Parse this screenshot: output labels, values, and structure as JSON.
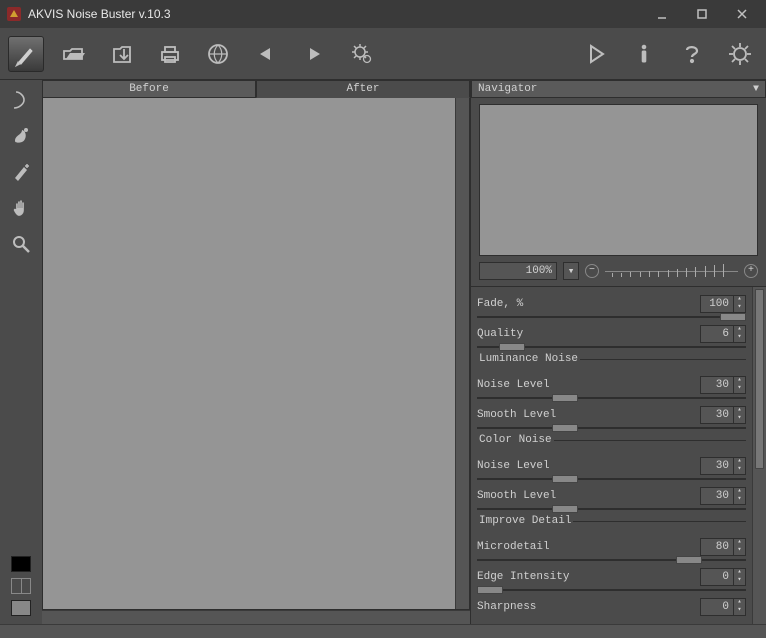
{
  "app": {
    "title": "AKVIS Noise Buster v.10.3"
  },
  "tabs": {
    "before": "Before",
    "after": "After"
  },
  "navigator": {
    "title": "Navigator",
    "zoom_value": "100%",
    "minus": "−",
    "plus": "+"
  },
  "params": {
    "fade": {
      "label": "Fade, %",
      "value": "100"
    },
    "quality": {
      "label": "Quality",
      "value": "6"
    },
    "luminance_title": "Luminance Noise",
    "lum_noise": {
      "label": "Noise Level",
      "value": "30"
    },
    "lum_smooth": {
      "label": "Smooth Level",
      "value": "30"
    },
    "color_title": "Color Noise",
    "col_noise": {
      "label": "Noise Level",
      "value": "30"
    },
    "col_smooth": {
      "label": "Smooth Level",
      "value": "30"
    },
    "improve_title": "Improve Detail",
    "microdetail": {
      "label": "Microdetail",
      "value": "80"
    },
    "edge": {
      "label": "Edge Intensity",
      "value": "0"
    },
    "sharp": {
      "label": "Sharpness",
      "value": "0"
    }
  }
}
